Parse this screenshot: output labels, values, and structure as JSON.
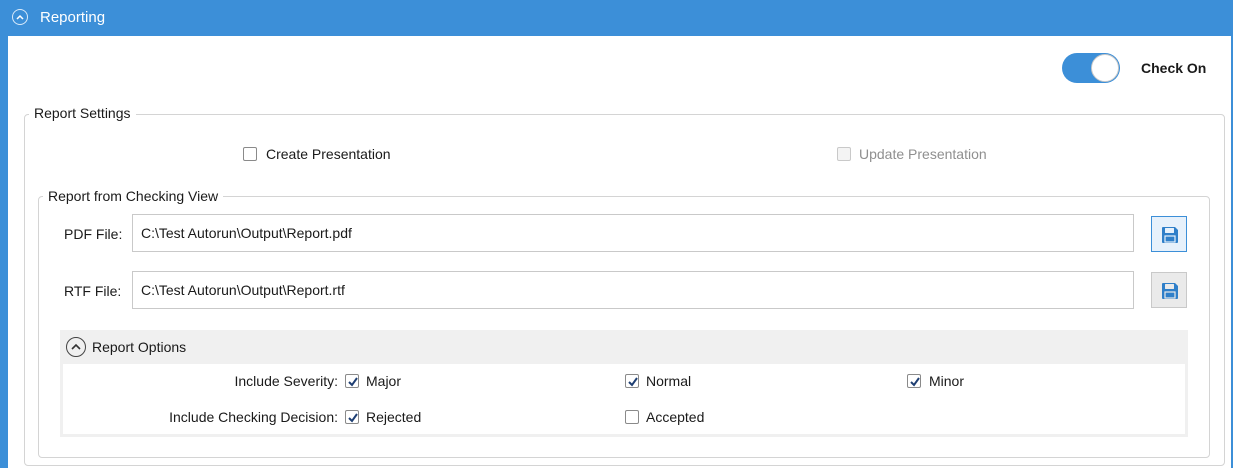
{
  "header": {
    "title": "Reporting"
  },
  "toggle": {
    "label": "Check On",
    "state": "on"
  },
  "report_settings": {
    "legend": "Report Settings",
    "create_presentation": {
      "label": "Create Presentation",
      "checked": false
    },
    "update_presentation": {
      "label": "Update Presentation",
      "checked": false,
      "disabled": true
    }
  },
  "checking_view": {
    "legend": "Report from Checking View",
    "pdf": {
      "label": "PDF File:",
      "value": "C:\\Test Autorun\\Output\\Report.pdf"
    },
    "rtf": {
      "label": "RTF File:",
      "value": "C:\\Test Autorun\\Output\\Report.rtf"
    }
  },
  "report_options": {
    "title": "Report Options",
    "severity": {
      "label": "Include Severity:",
      "major": {
        "label": "Major",
        "checked": true
      },
      "normal": {
        "label": "Normal",
        "checked": true
      },
      "minor": {
        "label": "Minor",
        "checked": true
      }
    },
    "decision": {
      "label": "Include Checking Decision:",
      "rejected": {
        "label": "Rejected",
        "checked": true
      },
      "accepted": {
        "label": "Accepted",
        "checked": false
      }
    }
  },
  "colors": {
    "accent": "#3c8fd8",
    "border": "#d4d4d4"
  }
}
